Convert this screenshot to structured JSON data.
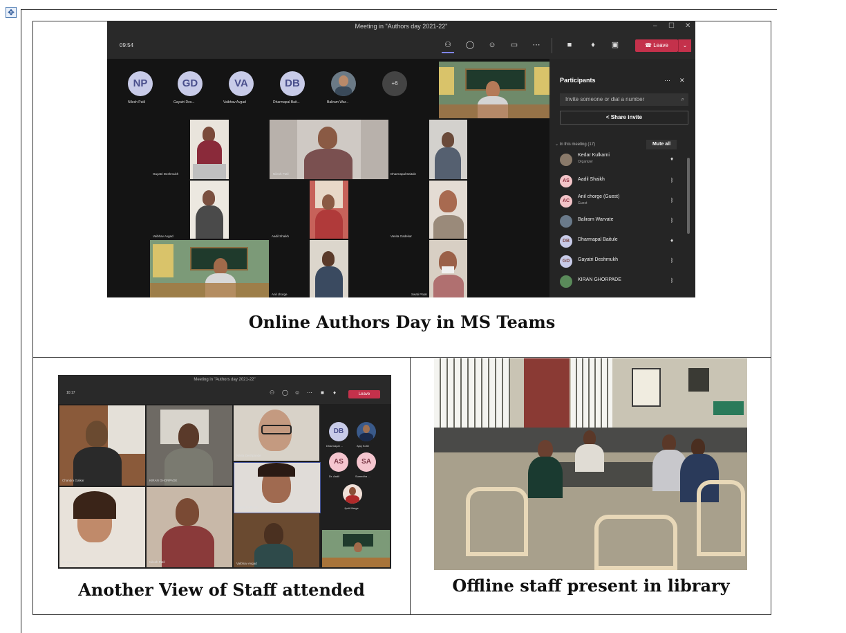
{
  "captions": {
    "main": "Online Authors Day in MS Teams",
    "left": "Another View of Staff attended",
    "right": "Offline staff present in library"
  },
  "teams_main": {
    "window_title": "Meeting in \"Authors day 2021-22\"",
    "clock": "09:54",
    "leave_label": "Leave",
    "avatars": [
      {
        "initials": "NP",
        "name": "Nilesh Patil"
      },
      {
        "initials": "GD",
        "name": "Gayatri Des..."
      },
      {
        "initials": "VA",
        "name": "Vaibhav Avgad"
      },
      {
        "initials": "DB",
        "name": "Dharmapal Bait..."
      },
      {
        "initials": "",
        "name": "Baliram War..."
      }
    ],
    "more_count": "+6",
    "video_names": {
      "gayatri": "Gayatri Deshmukh",
      "nilesh": "Nilesh Patil",
      "dharmapal": "Dharmapal Baitule",
      "vaibhav": "Vaibhav Avgad",
      "aadil": "Aadil Shaikh",
      "vanita": "Vanita Gadekar",
      "anil": "Anil chorge",
      "swati": "Swati Patar"
    },
    "participants": {
      "title": "Participants",
      "invite_placeholder": "Invite someone or dial a number",
      "share_invite": "Share invite",
      "in_meeting": "In this meeting (17)",
      "mute_all": "Mute all",
      "list": [
        {
          "initials": "",
          "name": "Kedar Kulkarni",
          "sub": "Organizer"
        },
        {
          "initials": "AS",
          "name": "Aadil Shaikh",
          "sub": ""
        },
        {
          "initials": "AC",
          "name": "Anil chorge (Guest)",
          "sub": "Guest"
        },
        {
          "initials": "",
          "name": "Baliram Warvate",
          "sub": ""
        },
        {
          "initials": "DB",
          "name": "Dharmapal Baitule",
          "sub": ""
        },
        {
          "initials": "GD",
          "name": "Gayatri Deshmukh",
          "sub": ""
        },
        {
          "initials": "",
          "name": "KIRAN GHORPADE",
          "sub": ""
        }
      ]
    }
  },
  "teams_second": {
    "window_title": "Meeting in \"Authors day 2021-22\"",
    "clock": "10:17",
    "leave_label": "Leave",
    "side_avatars": [
      {
        "initials": "DB",
        "name": "Dharmapal ..."
      },
      {
        "initials": "",
        "name": "Ajay Kolte"
      },
      {
        "initials": "AS",
        "name": "Dr. Aadil"
      },
      {
        "initials": "SA",
        "name": "Sumedha ..."
      },
      {
        "initials": "",
        "name": "Jyoti Marge"
      }
    ],
    "video_names": [
      "Chandra Gaikar",
      "KIRAN GHORPADE",
      "Nikita Deshpande",
      "Sayali Kulkarni",
      "Dr. Kulkarni",
      "Nilesh Patil",
      "Vaibhav Avgad"
    ]
  },
  "colors": {
    "teams_bg": "#1f1f1f",
    "leave_red": "#c4314b",
    "avatar_lavender": "#c8cbe8"
  }
}
